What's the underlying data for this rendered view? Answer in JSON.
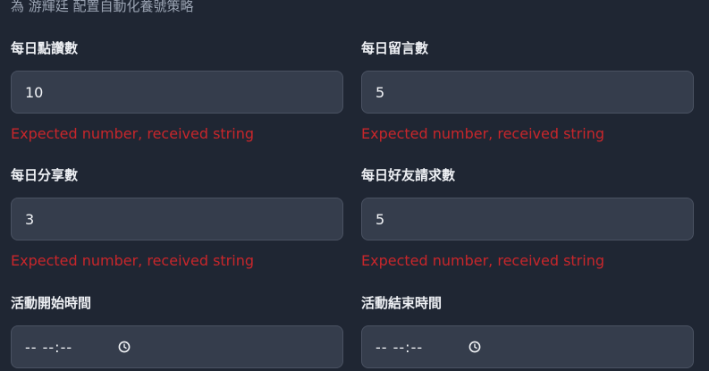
{
  "form": {
    "subtitle": "為 游輝廷 配置自動化養號策略",
    "fields": [
      {
        "label": "每日點讚數",
        "value": "10",
        "error": "Expected number, received string"
      },
      {
        "label": "每日留言數",
        "value": "5",
        "error": "Expected number, received string"
      },
      {
        "label": "每日分享數",
        "value": "3",
        "error": "Expected number, received string"
      },
      {
        "label": "每日好友請求數",
        "value": "5",
        "error": "Expected number, received string"
      }
    ],
    "time_fields": [
      {
        "label": "活動開始時間",
        "value": "-- --:--",
        "icon": "clock-icon"
      },
      {
        "label": "活動結束時間",
        "value": "-- --:--",
        "icon": "clock-icon"
      }
    ]
  },
  "colors": {
    "background": "#1f2633",
    "input_bg": "#353d4c",
    "error": "#c8262b"
  }
}
